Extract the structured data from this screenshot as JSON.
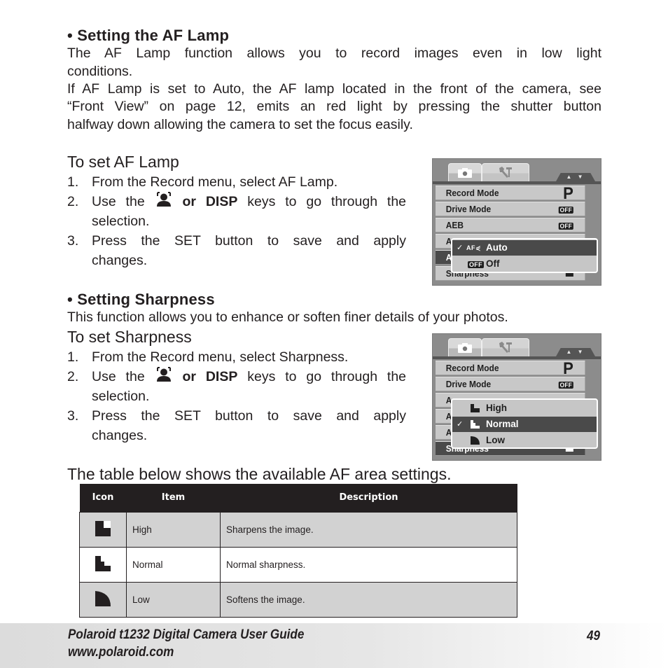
{
  "section_af_lamp": {
    "heading": "Setting the AF Lamp",
    "para1_line1": "The AF Lamp function allows you to record images even in low light",
    "para1_line2": "conditions.",
    "para2_line1": "If AF Lamp is set to Auto, the AF lamp located in the front of the camera, see",
    "para2_line2": "“Front View” on page 12, emits an red light by pressing the shutter button",
    "para2_line3": "halfway down allowing the camera to set the focus easily.",
    "howto_title": "To set AF Lamp",
    "steps": [
      {
        "num": "1.",
        "text": "From the Record menu, select AF Lamp."
      },
      {
        "num": "2.",
        "pre": "Use the",
        "key_icon": "face-detect-key-icon",
        "bold": "or DISP",
        "post": "keys to go through the",
        "cont": "selection."
      },
      {
        "num": "3.",
        "line1": "Press the SET button to save and apply",
        "cont": "changes."
      }
    ]
  },
  "section_sharpness": {
    "heading": "Setting Sharpness",
    "para": "This function allows you to enhance or soften finer details of your photos.",
    "howto_title": "To set Sharpness",
    "steps": [
      {
        "num": "1.",
        "text": "From the Record menu, select Sharpness."
      },
      {
        "num": "2.",
        "pre": "Use the",
        "key_icon": "face-detect-key-icon",
        "bold": "or DISP",
        "post": "keys to go through the",
        "cont": "selection."
      },
      {
        "num": "3.",
        "line1": "Press the SET button to save and apply",
        "cont": "changes."
      }
    ]
  },
  "camera_menu_af": {
    "tabs": [
      "camera-icon",
      "tools-icon"
    ],
    "scroll_arrows": "▲ ▼",
    "rows": [
      {
        "label": "Record Mode",
        "value": "P"
      },
      {
        "label": "Drive Mode",
        "value": "OFF"
      },
      {
        "label": "AEB",
        "value": "OFF"
      },
      {
        "label": "A",
        "value": ""
      },
      {
        "label": "A",
        "value": ""
      },
      {
        "label": "Sharpness",
        "value": ""
      }
    ],
    "popup_options": [
      {
        "check": "✓",
        "icon_text": "AF",
        "label": "Auto",
        "selected": true
      },
      {
        "check": "",
        "icon_text": "OFF",
        "label": "Off",
        "selected": false
      }
    ]
  },
  "camera_menu_sharpness": {
    "tabs": [
      "camera-icon",
      "tools-icon"
    ],
    "scroll_arrows": "▲ ▼",
    "rows": [
      {
        "label": "Record Mode",
        "value": "P"
      },
      {
        "label": "Drive Mode",
        "value": "OFF"
      },
      {
        "label": "A",
        "value": ""
      },
      {
        "label": "A",
        "value": ""
      },
      {
        "label": "A",
        "value": ""
      },
      {
        "label": "Sharpness",
        "value": ""
      }
    ],
    "popup_options": [
      {
        "check": "",
        "icon": "sharpness-high-icon",
        "label": "High",
        "selected": false
      },
      {
        "check": "✓",
        "icon": "sharpness-normal-icon",
        "label": "Normal",
        "selected": true
      },
      {
        "check": "",
        "icon": "sharpness-low-icon",
        "label": "Low",
        "selected": false
      }
    ]
  },
  "table_intro": "The table below shows the available AF area settings.",
  "table": {
    "headers": [
      "Icon",
      "Item",
      "Description"
    ],
    "rows": [
      {
        "icon": "sharpness-high-icon",
        "item": "High",
        "description": "Sharpens the image."
      },
      {
        "icon": "sharpness-normal-icon",
        "item": "Normal",
        "description": "Normal sharpness."
      },
      {
        "icon": "sharpness-low-icon",
        "item": "Low",
        "description": "Softens the image."
      }
    ]
  },
  "footer": {
    "title": "Polaroid t1232 Digital Camera User Guide",
    "url": "www.polaroid.com",
    "page_number": "49"
  }
}
